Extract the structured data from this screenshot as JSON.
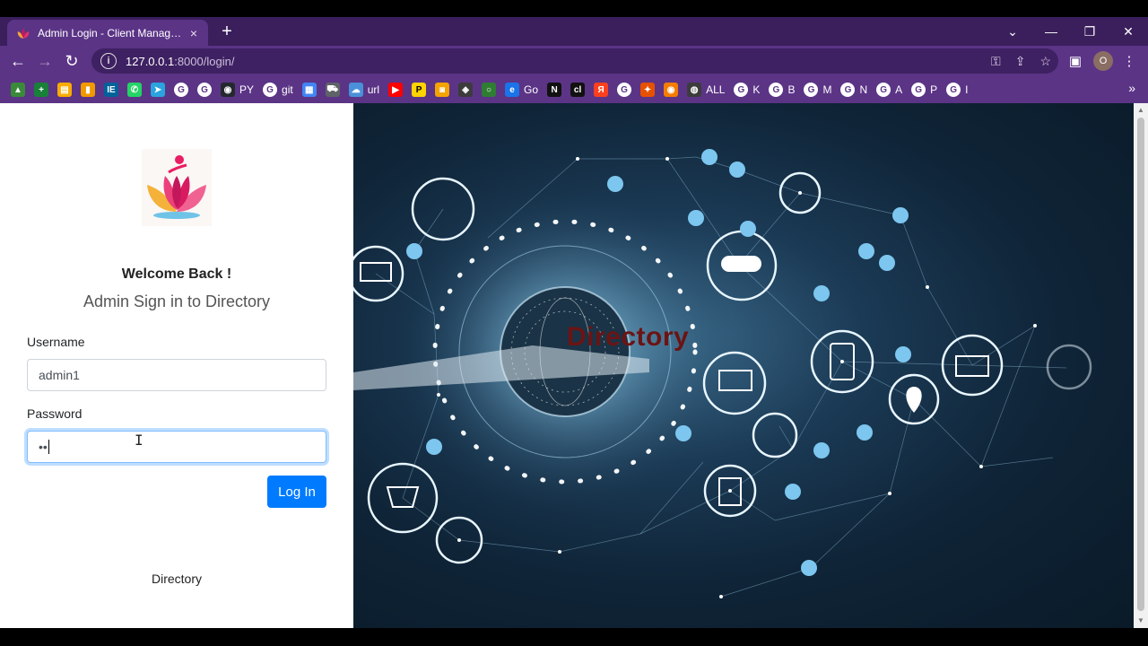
{
  "browser": {
    "tab_title": "Admin Login - Client Manageme",
    "tab_close": "×",
    "new_tab": "+",
    "url_host": "127.0.0.1",
    "url_path": ":8000/login/",
    "profile_initial": "O",
    "bookmarks": [
      {
        "icon": "app-icon",
        "label": ""
      },
      {
        "icon": "plus-app-icon",
        "label": ""
      },
      {
        "icon": "folder-icon",
        "label": ""
      },
      {
        "icon": "chart-icon",
        "label": ""
      },
      {
        "icon": "ieee-icon",
        "label": ""
      },
      {
        "icon": "whatsapp-icon",
        "label": ""
      },
      {
        "icon": "telegram-icon",
        "label": ""
      },
      {
        "icon": "google-icon",
        "label": ""
      },
      {
        "icon": "google-icon",
        "label": ""
      },
      {
        "icon": "github-icon",
        "label": "PY"
      },
      {
        "icon": "google-icon",
        "label": "git"
      },
      {
        "icon": "calendar-icon",
        "label": ""
      },
      {
        "icon": "car-icon",
        "label": ""
      },
      {
        "icon": "cloud-icon",
        "label": "url"
      },
      {
        "icon": "youtube-icon",
        "label": ""
      },
      {
        "icon": "p-icon",
        "label": ""
      },
      {
        "icon": "camera-icon",
        "label": ""
      },
      {
        "icon": "shield-icon",
        "label": ""
      },
      {
        "icon": "circle-icon",
        "label": ""
      },
      {
        "icon": "edge-icon",
        "label": "Go"
      },
      {
        "icon": "notion-icon",
        "label": ""
      },
      {
        "icon": "cl-icon",
        "label": ""
      },
      {
        "icon": "yandex-icon",
        "label": ""
      },
      {
        "icon": "google-icon",
        "label": ""
      },
      {
        "icon": "tools-icon",
        "label": ""
      },
      {
        "icon": "eye-icon",
        "label": ""
      },
      {
        "icon": "globe-icon",
        "label": "ALL"
      },
      {
        "icon": "google-icon",
        "label": "K"
      },
      {
        "icon": "google-icon",
        "label": "B"
      },
      {
        "icon": "google-icon",
        "label": "M"
      },
      {
        "icon": "google-icon",
        "label": "N"
      },
      {
        "icon": "google-icon",
        "label": "A"
      },
      {
        "icon": "google-icon",
        "label": "P"
      },
      {
        "icon": "google-icon",
        "label": "I"
      }
    ],
    "bookmarks_more": "»"
  },
  "login": {
    "welcome": "Welcome Back !",
    "subtitle": "Admin Sign in to Directory",
    "username_label": "Username",
    "username_value": "admin1",
    "password_label": "Password",
    "password_value": "••",
    "login_button": "Log In",
    "footer": "Directory"
  },
  "hero": {
    "title": "Directory"
  },
  "colors": {
    "chrome": "#5b3486",
    "primary": "#007bff",
    "hero_title": "#6b1414"
  }
}
